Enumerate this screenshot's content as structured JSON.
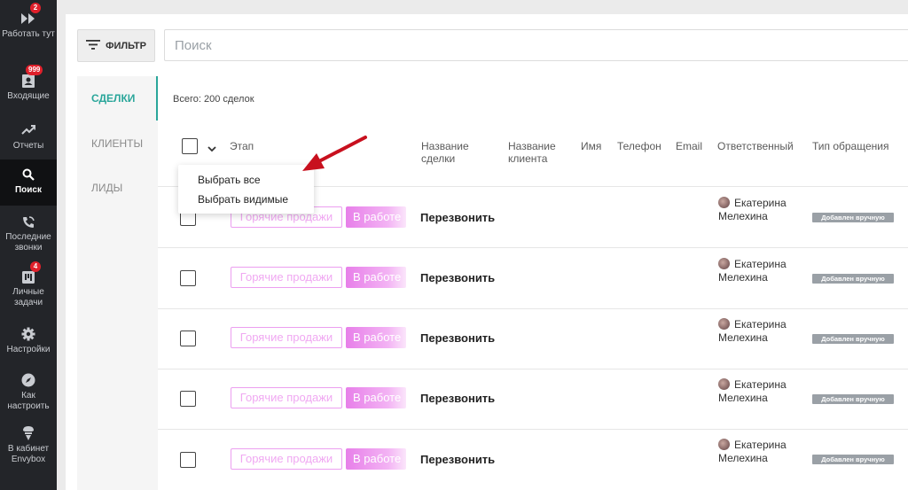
{
  "sidebar": {
    "items": [
      {
        "label": "Работать тут",
        "badge": "2",
        "icon": "fast-forward-icon"
      },
      {
        "label": "Входящие",
        "badge": "999",
        "icon": "inbox-icon"
      },
      {
        "label": "Отчеты",
        "badge": "",
        "icon": "trending-up-icon"
      },
      {
        "label": "Поиск",
        "badge": "",
        "icon": "search-icon",
        "active": true
      },
      {
        "label": "Последние звонки",
        "badge": "",
        "icon": "phone-call-icon"
      },
      {
        "label": "Личные задачи",
        "badge": "4",
        "icon": "tasks-icon"
      },
      {
        "label": "Настройки",
        "badge": "",
        "icon": "gear-icon"
      },
      {
        "label": "Как настроить",
        "badge": "",
        "icon": "compass-icon"
      },
      {
        "label": "В кабинет Envybox",
        "badge": "",
        "icon": "envybox-icon"
      }
    ]
  },
  "toolbar": {
    "filter_label": "ФИЛЬТР",
    "search_placeholder": "Поиск"
  },
  "tabs": [
    {
      "label": "СДЕЛКИ",
      "active": true
    },
    {
      "label": "КЛИЕНТЫ",
      "active": false
    },
    {
      "label": "ЛИДЫ",
      "active": false
    }
  ],
  "total_label": "Всего: 200 сделок",
  "columns": {
    "stage": "Этап",
    "deal_name": "Название сделки",
    "client_name": "Название клиента",
    "name": "Имя",
    "phone": "Телефон",
    "email": "Email",
    "responsible": "Ответственный",
    "request_type": "Тип обращения"
  },
  "select_menu": {
    "select_all": "Выбрать все",
    "select_visible": "Выбрать видимые"
  },
  "rows": [
    {
      "stage": "Горячие продажи",
      "status": "В работе",
      "deal": "Перезвонить",
      "responsible": [
        "Екатерина",
        "Мелехина"
      ],
      "type": "Добавлен вручную"
    },
    {
      "stage": "Горячие продажи",
      "status": "В работе",
      "deal": "Перезвонить",
      "responsible": [
        "Екатерина",
        "Мелехина"
      ],
      "type": "Добавлен вручную"
    },
    {
      "stage": "Горячие продажи",
      "status": "В работе",
      "deal": "Перезвонить",
      "responsible": [
        "Екатерина",
        "Мелехина"
      ],
      "type": "Добавлен вручную"
    },
    {
      "stage": "Горячие продажи",
      "status": "В работе",
      "deal": "Перезвонить",
      "responsible": [
        "Екатерина",
        "Мелехина"
      ],
      "type": "Добавлен вручную"
    },
    {
      "stage": "Горячие продажи",
      "status": "В работе",
      "deal": "Перезвонить",
      "responsible": [
        "Екатерина",
        "Мелехина"
      ],
      "type": "Добавлен вручную"
    }
  ],
  "colors": {
    "accent": "#2aa69a",
    "stage_pink": "#ec9ff0",
    "annotation_arrow": "#c8101e",
    "badge_red": "#e0202b"
  }
}
